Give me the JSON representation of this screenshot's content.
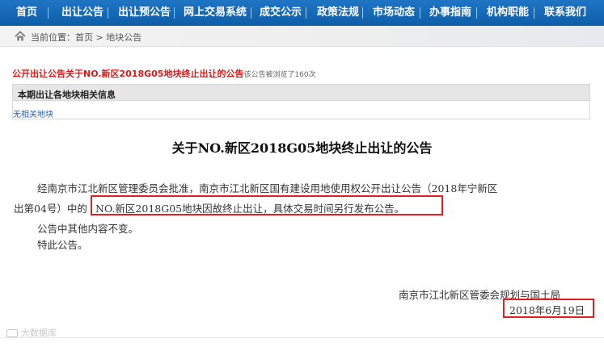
{
  "nav": {
    "items": [
      "首页",
      "出让公告",
      "出让预公告",
      "网上交易系统",
      "成交公示",
      "政策法规",
      "市场动态",
      "办事指南",
      "机构职能",
      "联系我们"
    ],
    "bg_color": "#0d5ea8"
  },
  "location": {
    "label": "当前位置：首页 > 地块公告",
    "icon": "home-icon"
  },
  "notice_header": {
    "title": "公开出让公告关于NO.新区2018G05地块终止出让的公告",
    "views": "该公告被浏览了160次"
  },
  "info_box": {
    "heading": "本期出让各地块相关信息",
    "link": "无相关地块"
  },
  "article": {
    "title": "关于NO.新区2018G05地块终止出让的公告",
    "line1": "经南京市江北新区管理委员会批准，南京市江北新区国有建设用地使用权公开出让公告（2018年宁新区",
    "line2_prefix": "出第04号）中的",
    "line2_highlight": "NO.新区2018G05地块因故终止出让，具体交易时间另行发布公告。",
    "line3": "公告中其他内容不变。",
    "line4": "特此公告。",
    "signature": "南京市江北新区管委会规划与国土局",
    "date": "2018年6月19日",
    "highlight_color": "#e01f1f"
  },
  "watermark": "大数据库"
}
